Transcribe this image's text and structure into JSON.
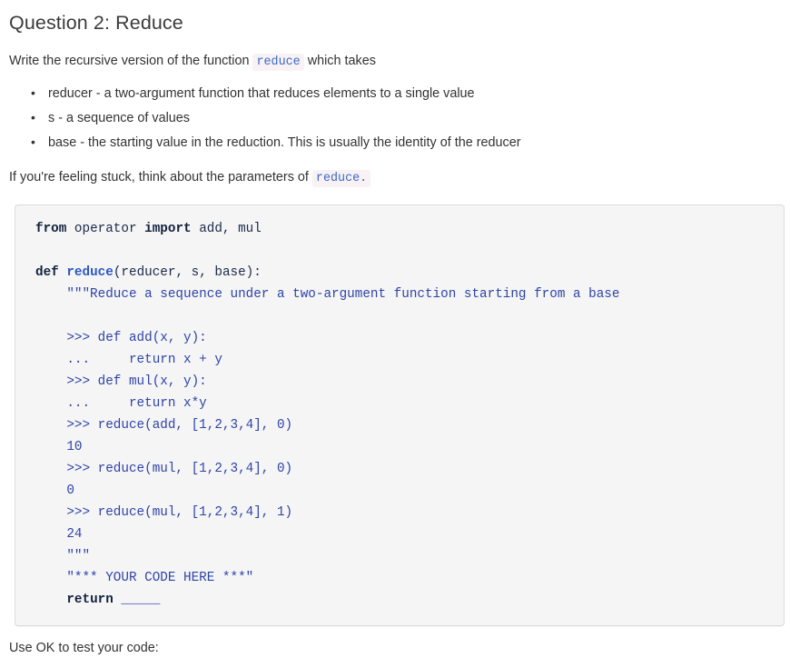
{
  "page": {
    "title": "Question 2: Reduce",
    "intro": {
      "before": "Write the recursive version of the function",
      "code": "reduce",
      "after": "which takes"
    },
    "bullets": [
      "reducer - a two-argument function that reduces elements to a single value",
      "s - a sequence of values",
      "base - the starting value in the reduction. This is usually the identity of the reducer"
    ],
    "hint": {
      "before": "If you're feeling stuck, think about the parameters of",
      "code": "reduce",
      "after": "."
    },
    "code_block": {
      "language": "python",
      "lines": [
        {
          "segments": [
            {
              "t": "from",
              "c": "k"
            },
            {
              "t": " operator ",
              "c": ""
            },
            {
              "t": "import",
              "c": "k"
            },
            {
              "t": " add, mul",
              "c": ""
            }
          ]
        },
        {
          "segments": []
        },
        {
          "segments": [
            {
              "t": "def",
              "c": "k"
            },
            {
              "t": " ",
              "c": ""
            },
            {
              "t": "reduce",
              "c": "fn"
            },
            {
              "t": "(reducer, s, base):",
              "c": ""
            }
          ]
        },
        {
          "segments": [
            {
              "t": "    \"\"\"Reduce a sequence under a two-argument function starting from a base",
              "c": "s"
            }
          ]
        },
        {
          "segments": []
        },
        {
          "segments": [
            {
              "t": "    >>> def add(x, y):",
              "c": "s"
            }
          ]
        },
        {
          "segments": [
            {
              "t": "    ...     return x + y",
              "c": "s"
            }
          ]
        },
        {
          "segments": [
            {
              "t": "    >>> def mul(x, y):",
              "c": "s"
            }
          ]
        },
        {
          "segments": [
            {
              "t": "    ...     return x*y",
              "c": "s"
            }
          ]
        },
        {
          "segments": [
            {
              "t": "    >>> reduce(add, [1,2,3,4], 0)",
              "c": "s"
            }
          ]
        },
        {
          "segments": [
            {
              "t": "    10",
              "c": "s"
            }
          ]
        },
        {
          "segments": [
            {
              "t": "    >>> reduce(mul, [1,2,3,4], 0)",
              "c": "s"
            }
          ]
        },
        {
          "segments": [
            {
              "t": "    0",
              "c": "s"
            }
          ]
        },
        {
          "segments": [
            {
              "t": "    >>> reduce(mul, [1,2,3,4], 1)",
              "c": "s"
            }
          ]
        },
        {
          "segments": [
            {
              "t": "    24",
              "c": "s"
            }
          ]
        },
        {
          "segments": [
            {
              "t": "    \"\"\"",
              "c": "s"
            }
          ]
        },
        {
          "segments": [
            {
              "t": "    \"*** YOUR CODE HERE ***\"",
              "c": "s"
            }
          ]
        },
        {
          "segments": [
            {
              "t": "    ",
              "c": ""
            },
            {
              "t": "return",
              "c": "k"
            },
            {
              "t": " ",
              "c": ""
            },
            {
              "t": "_____",
              "c": "s"
            }
          ]
        }
      ]
    },
    "tail_partial_text": "Use OK to test your code:"
  },
  "colors": {
    "page_background": "#ffffff",
    "body_text": "#333333",
    "title_text": "#3b3b3b",
    "inline_code_text": "#3a69c7",
    "inline_code_background": "#f9f2f4",
    "code_block_background": "#f5f5f5",
    "code_block_border": "#dcdcdc",
    "code_keyword": "#12213d",
    "code_function_name": "#2b57c4",
    "code_string": "#2f44a8",
    "code_default": "#1b2a4a"
  }
}
